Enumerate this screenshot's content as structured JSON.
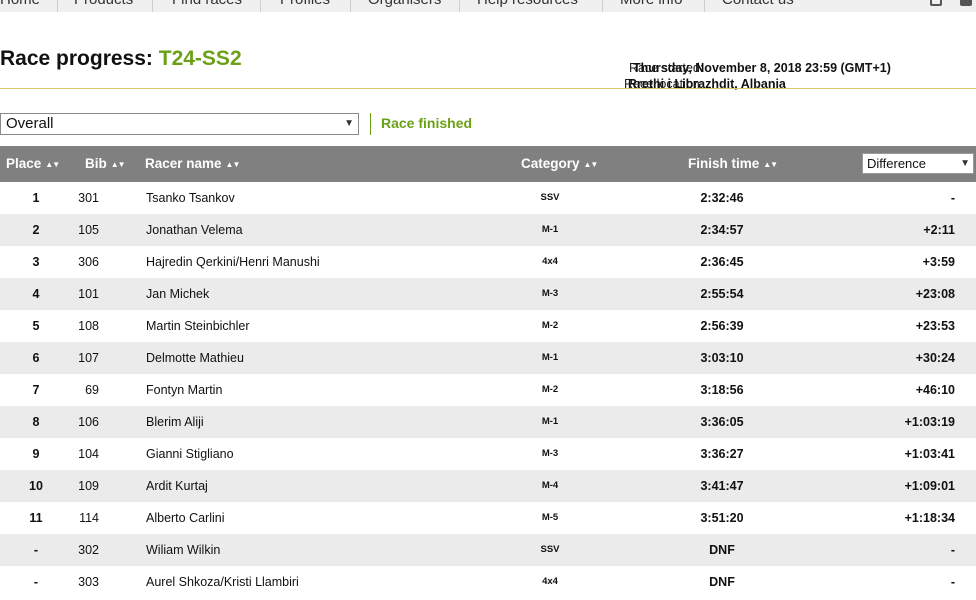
{
  "nav": {
    "items": [
      "Home",
      "Products",
      "Find races",
      "Profiles",
      "Organisers",
      "Help resources",
      "More info",
      "Contact us"
    ]
  },
  "header": {
    "title_prefix": "Race progress:",
    "race_code": "T24-SS2",
    "started_label": "Race started:",
    "started_value": "Thursday, November 8, 2018 23:59 (GMT+1)",
    "location_label": "Race location:",
    "location_value": "Rrethi i Librazhdit, Albania"
  },
  "filter": {
    "selected": "Overall",
    "status": "Race finished"
  },
  "table": {
    "columns": {
      "place": "Place",
      "bib": "Bib",
      "name": "Racer name",
      "category": "Category",
      "finish_time": "Finish time",
      "difference": "Difference"
    },
    "rows": [
      {
        "place": "1",
        "bib": "301",
        "name": "Tsanko Tsankov",
        "category": "SSV",
        "time": "2:32:46",
        "diff": "-"
      },
      {
        "place": "2",
        "bib": "105",
        "name": "Jonathan Velema",
        "category": "M-1",
        "time": "2:34:57",
        "diff": "+2:11"
      },
      {
        "place": "3",
        "bib": "306",
        "name": "Hajredin Qerkini/Henri Manushi",
        "category": "4x4",
        "time": "2:36:45",
        "diff": "+3:59"
      },
      {
        "place": "4",
        "bib": "101",
        "name": "Jan Michek",
        "category": "M-3",
        "time": "2:55:54",
        "diff": "+23:08"
      },
      {
        "place": "5",
        "bib": "108",
        "name": "Martin Steinbichler",
        "category": "M-2",
        "time": "2:56:39",
        "diff": "+23:53"
      },
      {
        "place": "6",
        "bib": "107",
        "name": "Delmotte Mathieu",
        "category": "M-1",
        "time": "3:03:10",
        "diff": "+30:24"
      },
      {
        "place": "7",
        "bib": "69",
        "name": "Fontyn Martin",
        "category": "M-2",
        "time": "3:18:56",
        "diff": "+46:10"
      },
      {
        "place": "8",
        "bib": "106",
        "name": "Blerim Aliji",
        "category": "M-1",
        "time": "3:36:05",
        "diff": "+1:03:19"
      },
      {
        "place": "9",
        "bib": "104",
        "name": "Gianni Stigliano",
        "category": "M-3",
        "time": "3:36:27",
        "diff": "+1:03:41"
      },
      {
        "place": "10",
        "bib": "109",
        "name": "Ardit Kurtaj",
        "category": "M-4",
        "time": "3:41:47",
        "diff": "+1:09:01"
      },
      {
        "place": "11",
        "bib": "114",
        "name": "Alberto Carlini",
        "category": "M-5",
        "time": "3:51:20",
        "diff": "+1:18:34"
      },
      {
        "place": "-",
        "bib": "302",
        "name": "Wiliam Wilkin",
        "category": "SSV",
        "time": "DNF",
        "diff": "-"
      },
      {
        "place": "-",
        "bib": "303",
        "name": "Aurel Shkoza/Kristi Llambiri",
        "category": "4x4",
        "time": "DNF",
        "diff": "-"
      }
    ]
  },
  "colors": {
    "accent": "#6aa116",
    "header_bg": "#808080",
    "row_alt": "#ebebeb"
  }
}
